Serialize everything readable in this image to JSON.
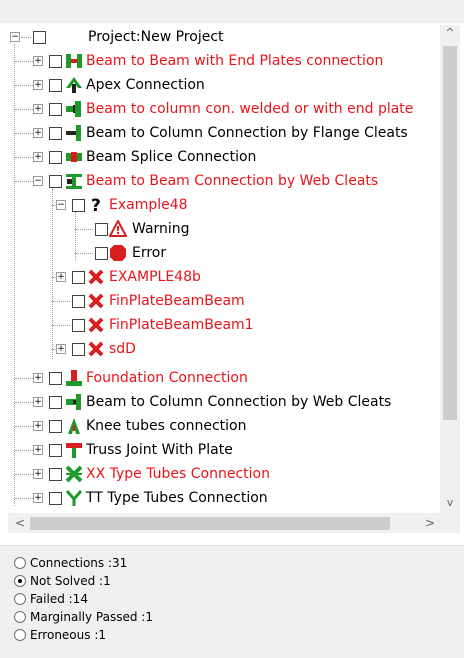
{
  "tree": {
    "root": {
      "label": "Project:New Project"
    },
    "items": [
      {
        "label": "Beam to Beam with End Plates connection",
        "color": "#e8141a",
        "icon": "beam-end-plates-icon"
      },
      {
        "label": "Apex Connection",
        "color": "#000000",
        "icon": "apex-connection-icon"
      },
      {
        "label": "Beam to column con. welded or with end plate",
        "color": "#e8141a",
        "icon": "beam-column-welded-icon"
      },
      {
        "label": "Beam to Column Connection by Flange Cleats",
        "color": "#000000",
        "icon": "flange-cleats-icon"
      },
      {
        "label": "Beam Splice Connection",
        "color": "#000000",
        "icon": "beam-splice-icon"
      },
      {
        "label": "Beam to Beam Connection by Web Cleats",
        "color": "#e8141a",
        "icon": "web-cleats-icon"
      },
      {
        "label": "Example48",
        "color": "#e8141a",
        "icon": "question-icon"
      },
      {
        "label": "Warning",
        "color": "#000000",
        "icon": "warning-icon"
      },
      {
        "label": "Error",
        "color": "#000000",
        "icon": "error-icon"
      },
      {
        "label": "EXAMPLE48b",
        "color": "#e8141a",
        "icon": "red-x-icon"
      },
      {
        "label": "FinPlateBeamBeam",
        "color": "#e8141a",
        "icon": "red-x-icon"
      },
      {
        "label": "FinPlateBeamBeam1",
        "color": "#e8141a",
        "icon": "red-x-icon"
      },
      {
        "label": "sdD",
        "color": "#e8141a",
        "icon": "red-x-icon"
      },
      {
        "label": "Foundation Connection",
        "color": "#e8141a",
        "icon": "foundation-icon"
      },
      {
        "label": "Beam to Column Connection by Web Cleats",
        "color": "#000000",
        "icon": "column-web-cleats-icon"
      },
      {
        "label": "Knee tubes connection",
        "color": "#000000",
        "icon": "knee-tubes-icon"
      },
      {
        "label": "Truss Joint With Plate",
        "color": "#000000",
        "icon": "truss-joint-icon"
      },
      {
        "label": "XX Type Tubes Connection",
        "color": "#e8141a",
        "icon": "xx-tubes-icon"
      },
      {
        "label": "TT Type Tubes Connection",
        "color": "#000000",
        "icon": "tt-tubes-icon"
      }
    ]
  },
  "scroll": {
    "up": "^",
    "down": "v",
    "left": "<",
    "right": ">"
  },
  "filters": [
    {
      "label": "Connections :31",
      "selected": false
    },
    {
      "label": "Not Solved :1",
      "selected": true
    },
    {
      "label": "Failed :14",
      "selected": false
    },
    {
      "label": "Marginally Passed :1",
      "selected": false
    },
    {
      "label": "Erroneous :1",
      "selected": false
    }
  ],
  "colors": {
    "red_text": "#e8141a",
    "scrollbar_track": "#f0f0f0",
    "scrollbar_thumb": "#cdcdcd",
    "icon_green": "#1f9a2a",
    "icon_red": "#d81e1e"
  }
}
